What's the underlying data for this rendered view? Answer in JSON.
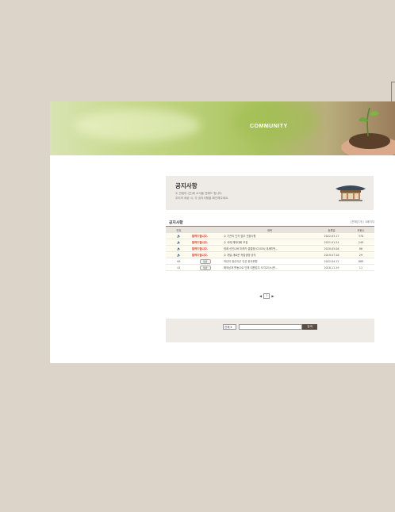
{
  "banner": {
    "title": "COMMUNITY"
  },
  "notice": {
    "title": "공지사항",
    "desc_line1": "수 안됨의 (간)제 소식을 전해드 립니다.",
    "desc_line2": "우리의 제공 시, 각 공지사항을 확인해주세요."
  },
  "list": {
    "title": "공지사항",
    "count": "[전체]7개 / 1페이지",
    "columns": [
      "번호",
      "",
      "제목",
      "등록일",
      "조회수"
    ],
    "rows": [
      {
        "num": "",
        "icon": "speaker-icon",
        "badge": "알려드립니다.",
        "title": "수 기관의 인허 업무 전환사항",
        "date": "2022.03.17",
        "views": "370"
      },
      {
        "num": "",
        "icon": "speaker-icon",
        "badge": "알려드립니다.",
        "title": "수 국제 해외대회 모집",
        "date": "2021.01.24",
        "views": "249"
      },
      {
        "num": "",
        "icon": "speaker-icon",
        "badge": "알려드립니다.",
        "title": "정례 신인니버 미래가 결결장(COOD) 대세미번...",
        "date": "2020.05.06",
        "views": "86"
      },
      {
        "num": "",
        "icon": "speaker-icon",
        "badge": "알려드립니다.",
        "title": "수 개발 새로운 작업생명 공지",
        "date": "2019.07.16",
        "views": "29"
      },
      {
        "num": "64",
        "icon": "",
        "badge": "일반",
        "title": "작년이 정신이군 인선 한국위원",
        "date": "2022.04.12",
        "views": "889"
      },
      {
        "num": "41",
        "icon": "",
        "badge": "일반",
        "title": "해외남게 활동으로 인해 대원업무 오각교사시판...",
        "date": "2018.11.19",
        "views": "11"
      }
    ]
  },
  "pager": {
    "prev": "◀",
    "page": "1",
    "next": "▶"
  },
  "search": {
    "select_value": "전체",
    "button": "검색"
  },
  "colors": {
    "accent": "#d62b1e",
    "button": "#5b4e44",
    "background": "#dcd3c9"
  }
}
